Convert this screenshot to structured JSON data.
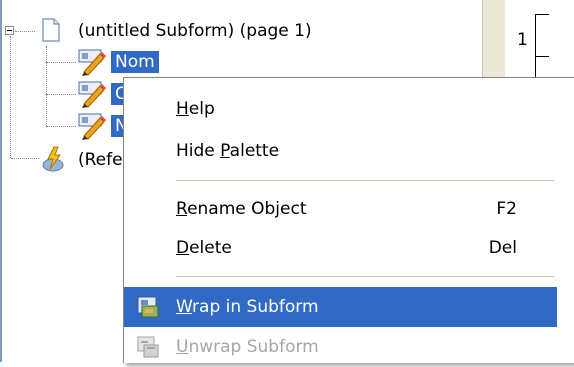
{
  "tree": {
    "root_label": "(untitled Subform) (page 1)",
    "children": [
      {
        "label": "Nom",
        "selected": true,
        "icon": "text-field-icon"
      },
      {
        "label": "C",
        "selected": true,
        "icon": "text-field-icon"
      },
      {
        "label": "N",
        "selected": true,
        "icon": "text-field-icon"
      }
    ],
    "script_label": "(Refe",
    "selection_color": "#316ac5"
  },
  "ruler": {
    "number": "1"
  },
  "context_menu": {
    "items": [
      {
        "mnemonic": "H",
        "rest": "elp",
        "shortcut": "",
        "state": "normal"
      },
      {
        "pre": "Hide ",
        "mnemonic": "P",
        "rest": "alette",
        "shortcut": "",
        "state": "normal"
      },
      {
        "mnemonic": "R",
        "rest": "ename Object",
        "shortcut": "F2",
        "state": "normal"
      },
      {
        "mnemonic": "D",
        "rest": "elete",
        "shortcut": "Del",
        "state": "normal"
      },
      {
        "mnemonic": "W",
        "rest": "rap in Subform",
        "shortcut": "",
        "state": "highlighted",
        "icon": "wrap-subform-icon"
      },
      {
        "mnemonic": "U",
        "rest": "nwrap Subform",
        "shortcut": "",
        "state": "disabled",
        "icon": "unwrap-subform-icon"
      }
    ],
    "highlight_color": "#316ac5"
  }
}
